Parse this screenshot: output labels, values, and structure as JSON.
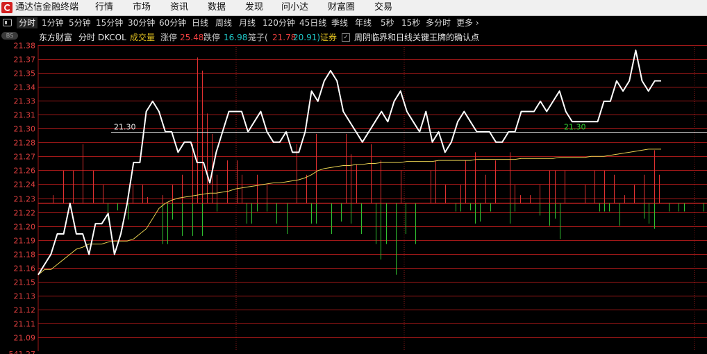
{
  "app": {
    "title": "通达信金融终端"
  },
  "menu": [
    "行情",
    "市场",
    "资讯",
    "数据",
    "发现",
    "问小达",
    "财富圈",
    "交易"
  ],
  "tabs": [
    "分时",
    "1分钟",
    "5分钟",
    "15分钟",
    "30分钟",
    "60分钟",
    "日线",
    "周线",
    "月线",
    "120分钟",
    "45日线",
    "季线",
    "年线",
    "5秒",
    "15秒",
    "多分时",
    "更多 ›"
  ],
  "active_tab": "分时",
  "info": {
    "stock_name": "东方财富",
    "view": "分时 DKCOL",
    "volume_label": "成交量",
    "up_label": "涨停",
    "up_value": "25.48",
    "down_label": "跌停",
    "down_value": "16.98",
    "cage_label": "笼子(",
    "cage_high": "21.78",
    "cage_low": "20.91)",
    "cert_label": "证券",
    "signal_text": "周阴临界和日线关键王牌的确认点"
  },
  "badge": "BS",
  "colors": {
    "background": "#000000",
    "grid": "#a01818",
    "price_line": "#ffffff",
    "avg_line": "#e8d050",
    "volume_up": "#e03030",
    "volume_down": "#30c030",
    "y_labels": "#e04040",
    "active_tab_bg": "#242424"
  },
  "chart_data": {
    "type": "line",
    "y_ticks": [
      "21.38",
      "21.37",
      "21.35",
      "21.34",
      "21.33",
      "21.31",
      "21.30",
      "21.28",
      "21.27",
      "21.26",
      "21.24",
      "21.23",
      "21.22",
      "21.20",
      "21.19",
      "21.18",
      "21.16",
      "21.15",
      "21.13",
      "21.12",
      "21.11",
      "21.09"
    ],
    "ylim": [
      21.085,
      21.385
    ],
    "baseline": 21.23,
    "ref_price": 21.3,
    "ref_left_label": "21.30",
    "ref_right_label": "21.30",
    "bottom_partial_label": "541.27",
    "x_count": 99,
    "price": [
      21.16,
      21.17,
      21.18,
      21.2,
      21.2,
      21.23,
      21.2,
      21.2,
      21.18,
      21.21,
      21.21,
      21.22,
      21.18,
      21.2,
      21.23,
      21.27,
      21.27,
      21.32,
      21.33,
      21.32,
      21.3,
      21.3,
      21.28,
      21.29,
      21.29,
      21.27,
      21.27,
      21.25,
      21.28,
      21.3,
      21.32,
      21.32,
      21.32,
      21.3,
      21.31,
      21.32,
      21.3,
      21.29,
      21.29,
      21.3,
      21.28,
      21.28,
      21.3,
      21.34,
      21.33,
      21.35,
      21.36,
      21.35,
      21.32,
      21.31,
      21.3,
      21.29,
      21.3,
      21.31,
      21.32,
      21.31,
      21.33,
      21.34,
      21.32,
      21.31,
      21.3,
      21.32,
      21.29,
      21.3,
      21.28,
      21.29,
      21.31,
      21.32,
      21.31,
      21.3,
      21.3,
      21.3,
      21.29,
      21.29,
      21.3,
      21.3,
      21.32,
      21.32,
      21.32,
      21.33,
      21.32,
      21.33,
      21.34,
      21.32,
      21.31,
      21.31,
      21.31,
      21.31,
      21.31,
      21.33,
      21.33,
      21.35,
      21.34,
      21.35,
      21.38,
      21.35,
      21.34,
      21.35,
      21.35
    ],
    "avg": [
      21.16,
      21.165,
      21.165,
      21.17,
      21.175,
      21.18,
      21.185,
      21.187,
      21.19,
      21.19,
      21.19,
      21.192,
      21.193,
      21.193,
      21.193,
      21.195,
      21.2,
      21.205,
      21.215,
      21.225,
      21.23,
      21.233,
      21.235,
      21.236,
      21.237,
      21.238,
      21.239,
      21.24,
      21.24,
      21.241,
      21.242,
      21.244,
      21.245,
      21.246,
      21.247,
      21.248,
      21.249,
      21.25,
      21.25,
      21.251,
      21.252,
      21.253,
      21.255,
      21.258,
      21.262,
      21.264,
      21.265,
      21.266,
      21.267,
      21.267,
      21.268,
      21.268,
      21.269,
      21.269,
      21.27,
      21.27,
      21.27,
      21.27,
      21.271,
      21.271,
      21.271,
      21.271,
      21.271,
      21.272,
      21.272,
      21.272,
      21.272,
      21.272,
      21.272,
      21.273,
      21.273,
      21.273,
      21.273,
      21.273,
      21.273,
      21.273,
      21.274,
      21.274,
      21.274,
      21.274,
      21.274,
      21.274,
      21.275,
      21.275,
      21.275,
      21.275,
      21.275,
      21.276,
      21.276,
      21.276,
      21.277,
      21.278,
      21.279,
      21.28,
      21.281,
      21.282,
      21.283,
      21.283,
      21.283
    ],
    "volume_up": [
      [
        3,
        21.238
      ],
      [
        5,
        21.262
      ],
      [
        7,
        21.262
      ],
      [
        9,
        21.288
      ],
      [
        11,
        21.262
      ],
      [
        13,
        21.248
      ],
      [
        19,
        21.248
      ],
      [
        21,
        21.248
      ],
      [
        22,
        21.236
      ],
      [
        25,
        21.238
      ],
      [
        27,
        21.248
      ],
      [
        29,
        21.258
      ],
      [
        31,
        21.288
      ],
      [
        32,
        21.373
      ],
      [
        33,
        21.36
      ],
      [
        34,
        21.318
      ],
      [
        35,
        21.298
      ],
      [
        36,
        21.258
      ],
      [
        38,
        21.272
      ],
      [
        40,
        21.272
      ],
      [
        41,
        21.258
      ],
      [
        44,
        21.258
      ],
      [
        46,
        21.248
      ],
      [
        52,
        21.288
      ],
      [
        54,
        21.258
      ],
      [
        56,
        21.298
      ],
      [
        62,
        21.298
      ],
      [
        63,
        21.278
      ],
      [
        64,
        21.268
      ],
      [
        67,
        21.288
      ],
      [
        69,
        21.272
      ],
      [
        73,
        21.262
      ],
      [
        79,
        21.262
      ],
      [
        80,
        21.272
      ],
      [
        82,
        21.248
      ],
      [
        85,
        21.248
      ],
      [
        86,
        21.272
      ],
      [
        88,
        21.28
      ],
      [
        90,
        21.258
      ],
      [
        92,
        21.272
      ],
      [
        95,
        21.28
      ],
      [
        96,
        21.248
      ],
      [
        97,
        21.238
      ],
      [
        99,
        21.238
      ],
      [
        101,
        21.248
      ],
      [
        103,
        21.262
      ],
      [
        104,
        21.262
      ],
      [
        106,
        21.262
      ],
      [
        110,
        21.248
      ],
      [
        112,
        21.262
      ],
      [
        114,
        21.262
      ],
      [
        116,
        21.258
      ],
      [
        118,
        21.238
      ],
      [
        120,
        21.248
      ],
      [
        122,
        21.258
      ],
      [
        124,
        21.282
      ],
      [
        125,
        21.258
      ]
    ],
    "volume_down": [
      [
        14,
        21.214
      ],
      [
        16,
        21.223
      ],
      [
        18,
        21.214
      ],
      [
        25,
        21.19
      ],
      [
        26,
        21.19
      ],
      [
        27,
        21.214
      ],
      [
        29,
        21.198
      ],
      [
        31,
        21.198
      ],
      [
        33,
        21.198
      ],
      [
        36,
        21.222
      ],
      [
        42,
        21.21
      ],
      [
        43,
        21.21
      ],
      [
        44,
        21.222
      ],
      [
        46,
        21.222
      ],
      [
        48,
        21.21
      ],
      [
        50,
        21.2
      ],
      [
        55,
        21.21
      ],
      [
        56,
        21.21
      ],
      [
        59,
        21.2
      ],
      [
        61,
        21.212
      ],
      [
        63,
        21.21
      ],
      [
        65,
        21.2
      ],
      [
        68,
        21.19
      ],
      [
        69,
        21.175
      ],
      [
        70,
        21.19
      ],
      [
        72,
        21.16
      ],
      [
        74,
        21.2
      ],
      [
        76,
        21.19
      ],
      [
        84,
        21.222
      ],
      [
        85,
        21.222
      ],
      [
        87,
        21.223
      ],
      [
        88,
        21.21
      ],
      [
        89,
        21.212
      ],
      [
        91,
        21.222
      ],
      [
        95,
        21.21
      ],
      [
        96,
        21.222
      ],
      [
        101,
        21.218
      ],
      [
        103,
        21.208
      ],
      [
        104,
        21.215
      ],
      [
        105,
        21.195
      ],
      [
        113,
        21.222
      ],
      [
        114,
        21.222
      ],
      [
        115,
        21.222
      ],
      [
        117,
        21.208
      ],
      [
        122,
        21.215
      ],
      [
        123,
        21.21
      ],
      [
        124,
        21.205
      ],
      [
        127,
        21.222
      ],
      [
        129,
        21.222
      ],
      [
        130,
        21.222
      ],
      [
        134,
        21.222
      ],
      [
        137,
        21.225
      ]
    ]
  }
}
